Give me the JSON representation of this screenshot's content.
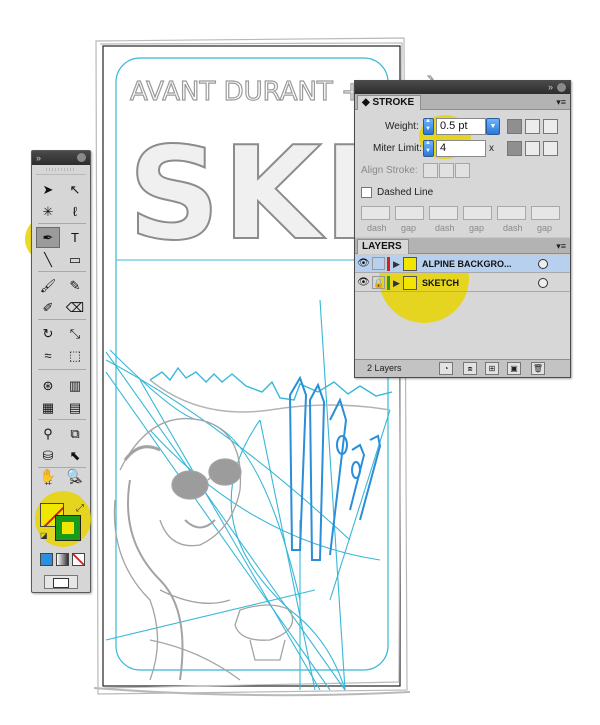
{
  "artboard": {
    "sketch_text_top": "AVANT DURANT + APRÈ",
    "sketch_text_big": "SKI"
  },
  "tools_panel": {
    "tools": [
      {
        "name": "selection-tool",
        "glyph": "➤"
      },
      {
        "name": "direct-selection-tool",
        "glyph": "↖"
      },
      {
        "name": "magic-wand-tool",
        "glyph": "✳"
      },
      {
        "name": "lasso-tool",
        "glyph": "ℓ"
      },
      {
        "name": "pen-tool",
        "glyph": "✒",
        "selected": true
      },
      {
        "name": "type-tool",
        "glyph": "T"
      },
      {
        "name": "line-tool",
        "glyph": "╲"
      },
      {
        "name": "rectangle-tool",
        "glyph": "▭"
      },
      {
        "name": "paintbrush-tool",
        "glyph": "🖌"
      },
      {
        "name": "pencil-tool",
        "glyph": "✎"
      },
      {
        "name": "blob-brush-tool",
        "glyph": "✐"
      },
      {
        "name": "eraser-tool",
        "glyph": "⌫"
      },
      {
        "name": "rotate-tool",
        "glyph": "↻"
      },
      {
        "name": "scale-tool",
        "glyph": "⤡"
      },
      {
        "name": "warp-tool",
        "glyph": "≈"
      },
      {
        "name": "free-transform-tool",
        "glyph": "⬚"
      },
      {
        "name": "symbol-sprayer-tool",
        "glyph": "⊛"
      },
      {
        "name": "column-graph-tool",
        "glyph": "▥"
      },
      {
        "name": "mesh-tool",
        "glyph": "▦"
      },
      {
        "name": "gradient-tool",
        "glyph": "▤"
      },
      {
        "name": "eyedropper-tool",
        "glyph": "⚲"
      },
      {
        "name": "blend-tool",
        "glyph": "⧉"
      },
      {
        "name": "live-paint-bucket-tool",
        "glyph": "⛁"
      },
      {
        "name": "live-paint-selection-tool",
        "glyph": "⬉"
      },
      {
        "name": "crop-area-tool",
        "glyph": "⌗"
      },
      {
        "name": "slice-tool",
        "glyph": "✂"
      },
      {
        "name": "hand-tool",
        "glyph": "✋"
      },
      {
        "name": "zoom-tool",
        "glyph": "🔍"
      }
    ],
    "colors": {
      "fill": "#f2e600",
      "stroke": "#1a9a1a",
      "highlight": "#e8d400"
    }
  },
  "stroke_panel": {
    "tab_label": "STROKE",
    "weight_label": "Weight:",
    "weight_value": "0.5 pt",
    "miter_label": "Miter Limit:",
    "miter_value": "4",
    "miter_unit": "x",
    "align_label": "Align Stroke:",
    "dashed_label": "Dashed Line",
    "dash_labels": [
      "dash",
      "gap",
      "dash",
      "gap",
      "dash",
      "gap"
    ]
  },
  "layers_panel": {
    "tab_label": "LAYERS",
    "layers": [
      {
        "name": "ALPINE BACKGRO...",
        "color": "#d42020",
        "active": true,
        "locked": false
      },
      {
        "name": "SKETCH",
        "color": "#2a9a2a",
        "active": false,
        "locked": true
      }
    ],
    "status": "2 Layers"
  }
}
